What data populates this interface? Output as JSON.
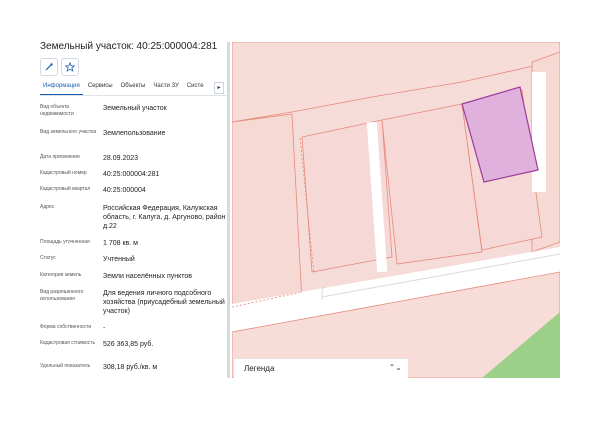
{
  "panel": {
    "title": "Земельный участок: 40:25:000004:281",
    "tabs": [
      "Информация",
      "Сервисы",
      "Объекты",
      "Части ЗУ",
      "Систе"
    ],
    "tab_arrow": "▸",
    "rows": [
      {
        "label": "Вид объекта недвижимости",
        "value": "Земельный участок"
      },
      {
        "label": "Вид земельного участка",
        "value": "Землепользование"
      },
      {
        "label": "Дата присвоения",
        "value": "28.09.2023"
      },
      {
        "label": "Кадастровый номер",
        "value": "40:25:000004:281"
      },
      {
        "label": "Кадастровый квартал",
        "value": "40:25:000004"
      },
      {
        "label": "Адрес",
        "value": "Российская Федерация, Калужская область, г. Калуга, д. Аргуново, район д.22"
      },
      {
        "label": "Площадь уточненная",
        "value": "1 708 кв. м"
      },
      {
        "label": "Статус",
        "value": "Учтенный"
      },
      {
        "label": "Категория земель",
        "value": "Земли населённых пунктов"
      },
      {
        "label": "Вид разрешенного использования",
        "value": "Для ведения личного подсобного хозяйства (приусадебный земельный участок)"
      },
      {
        "label": "Форма собственности",
        "value": "-"
      },
      {
        "label": "Кадастровая стоимость",
        "value": "526 363,85 руб."
      },
      {
        "label": "Удельный показатель",
        "value": "308,18 руб./кв. м"
      }
    ]
  },
  "map": {
    "legend_label": "Легенда",
    "legend_arrow": "⌃⌄",
    "colors": {
      "parcel_fill": "#f6d9d6",
      "parcel_border": "#e58a7c",
      "selected_fill": "#e0b1dc",
      "selected_border": "#9d3b9b",
      "road": "#ffffff",
      "green": "#9ccf88"
    }
  }
}
